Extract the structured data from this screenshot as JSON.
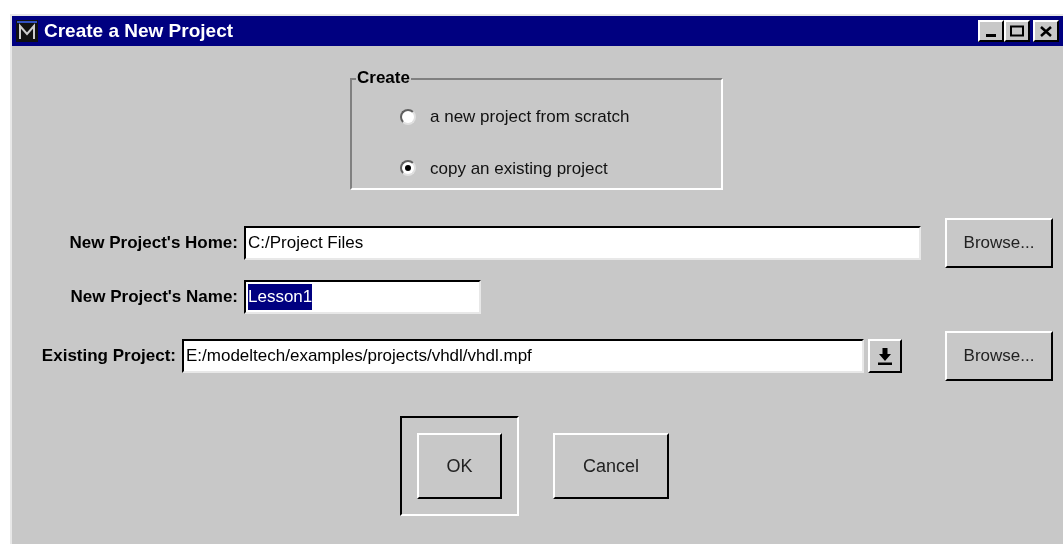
{
  "window": {
    "title": "Create a New Project"
  },
  "create_group": {
    "title": "Create",
    "options": [
      {
        "label": "a new project from scratch",
        "selected": false
      },
      {
        "label": "copy an existing project",
        "selected": true
      }
    ]
  },
  "fields": [
    {
      "kind": "browse",
      "label": "New Project's Home:",
      "value": "C:/Project Files",
      "value_selected": false,
      "button": "Browse..."
    },
    {
      "kind": "text",
      "label": "New Project's Name:",
      "value": "Lesson1",
      "value_selected": true
    },
    {
      "kind": "combo",
      "label": "Existing Project:",
      "value": "E:/modeltech/examples/projects/vhdl/vhdl.mpf",
      "value_selected": false,
      "button": "Browse..."
    }
  ],
  "buttons": [
    {
      "label": "OK",
      "default": true
    },
    {
      "label": "Cancel",
      "default": false
    }
  ]
}
